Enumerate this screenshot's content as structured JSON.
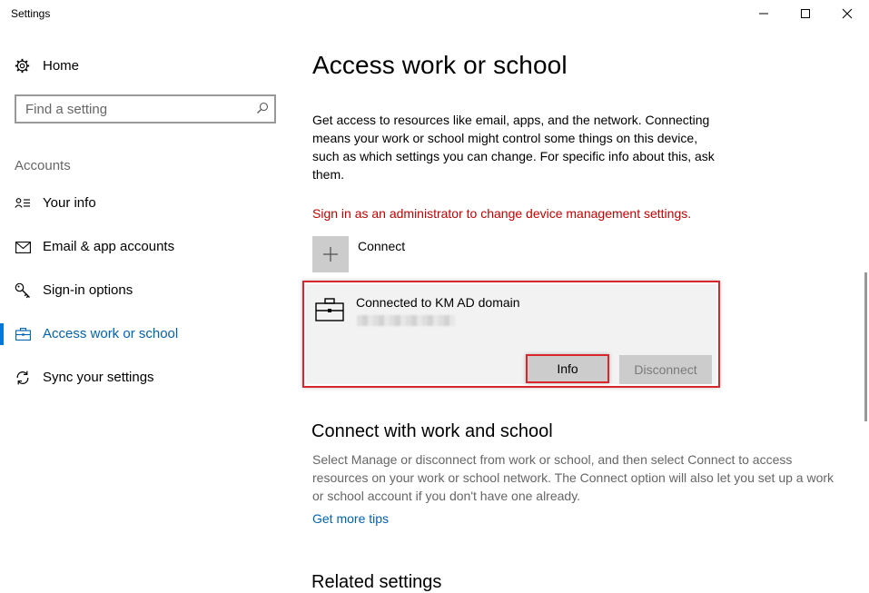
{
  "window": {
    "title": "Settings",
    "controls": [
      "minimize-icon",
      "maximize-icon",
      "close-icon"
    ]
  },
  "sidebar": {
    "home_label": "Home",
    "search_placeholder": "Find a setting",
    "section_label": "Accounts",
    "items": [
      {
        "label": "Your info",
        "icon": "person-card-icon"
      },
      {
        "label": "Email & app accounts",
        "icon": "mail-icon"
      },
      {
        "label": "Sign-in options",
        "icon": "key-icon"
      },
      {
        "label": "Access work or school",
        "icon": "briefcase-icon",
        "active": true
      },
      {
        "label": "Sync your settings",
        "icon": "sync-icon"
      }
    ]
  },
  "main": {
    "title": "Access work or school",
    "description": "Get access to resources like email, apps, and the network. Connecting means your work or school might control some things on this device, such as which settings you can change. For specific info about this, ask them.",
    "admin_warning": "Sign in as an administrator to change device management settings.",
    "connect_label": "Connect",
    "account": {
      "name": "Connected to KM AD domain",
      "info_label": "Info",
      "disconnect_label": "Disconnect"
    },
    "connect_section": {
      "title": "Connect with work and school",
      "description": "Select Manage or disconnect from work or school, and then select Connect to access resources on your work or school network. The Connect option will also let you set up a work or school account if you don't have one already.",
      "link": "Get more tips"
    },
    "related_title": "Related settings"
  },
  "colors": {
    "accent": "#0078d7",
    "link": "#0063b1",
    "warning": "#c50000",
    "highlight_border": "#d9252b"
  }
}
